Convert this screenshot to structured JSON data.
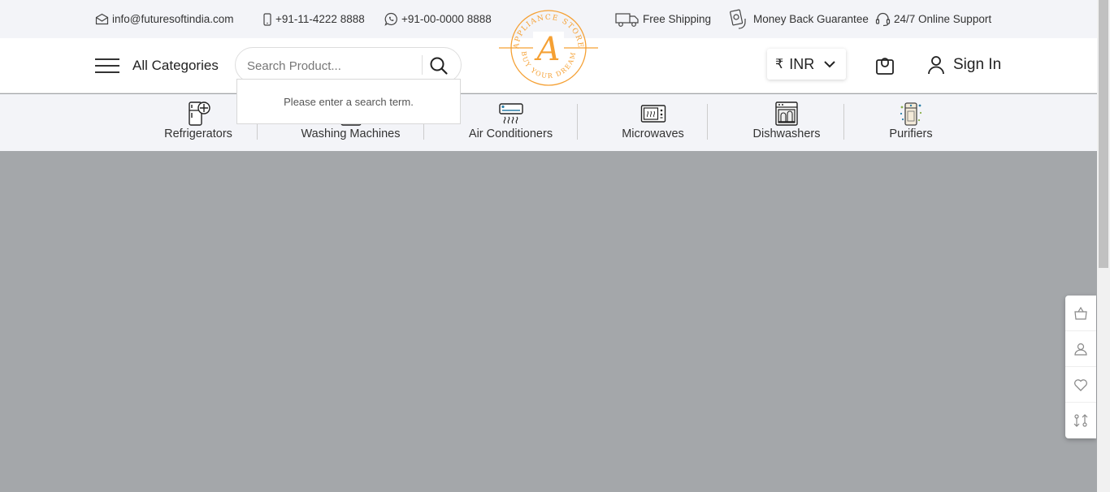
{
  "topbar": {
    "email": "info@futuresoftindia.com",
    "phone": "+91-11-4222 8888",
    "whatsapp": "+91-00-0000 8888",
    "free_shipping": "Free Shipping",
    "money_back": "Money Back Guarantee",
    "support": "24/7 Online Support"
  },
  "header": {
    "all_categories": "All Categories",
    "search_placeholder": "Search Product...",
    "search_hint": "Please enter a search term.",
    "currency_symbol": "₹",
    "currency": "INR",
    "sign_in": "Sign In"
  },
  "logo": {
    "letter": "A",
    "arc_top": "APPLIANCE STORE",
    "arc_bottom": "BUY YOUR DREAM",
    "color": "#f5a033"
  },
  "categories": [
    {
      "label": "Refrigerators",
      "icon": "refrigerator-icon"
    },
    {
      "label": "Washing Machines",
      "icon": "washing-machine-icon"
    },
    {
      "label": "Air Conditioners",
      "icon": "air-conditioner-icon"
    },
    {
      "label": "Microwaves",
      "icon": "microwave-icon"
    },
    {
      "label": "Dishwashers",
      "icon": "dishwasher-icon"
    },
    {
      "label": "Purifiers",
      "icon": "purifier-icon"
    }
  ],
  "side_widget": [
    "shopping-bag-icon",
    "user-icon",
    "heart-icon",
    "compare-icon"
  ],
  "colors": {
    "brand_orange": "#f5a033",
    "overlay": "#a4a7aa",
    "topbar_bg": "#f3f4f8"
  }
}
